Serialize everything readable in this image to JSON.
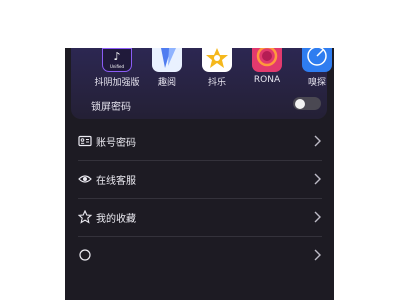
{
  "apps": [
    {
      "label": "抖阴加强版",
      "icon": "douyin-icon"
    },
    {
      "label": "趣阅",
      "icon": "quyue-icon"
    },
    {
      "label": "抖乐",
      "icon": "doule-icon"
    },
    {
      "label": "RONA",
      "icon": "rona-icon"
    },
    {
      "label": "嗅探",
      "icon": "xiutan-icon"
    }
  ],
  "app_badge_text": "Unified",
  "lock_screen": {
    "label": "锁屏密码",
    "enabled": false
  },
  "menu": [
    {
      "label": "账号密码",
      "icon": "id-card-icon"
    },
    {
      "label": "在线客服",
      "icon": "eye-icon"
    },
    {
      "label": "我的收藏",
      "icon": "star-icon"
    },
    {
      "label": "",
      "icon": "settings-icon"
    }
  ],
  "colors": {
    "background": "#1d1b23",
    "card": "#2c2752",
    "text": "#ecebf2",
    "divider": "#34323b",
    "toggle_off": "#4a4852"
  }
}
